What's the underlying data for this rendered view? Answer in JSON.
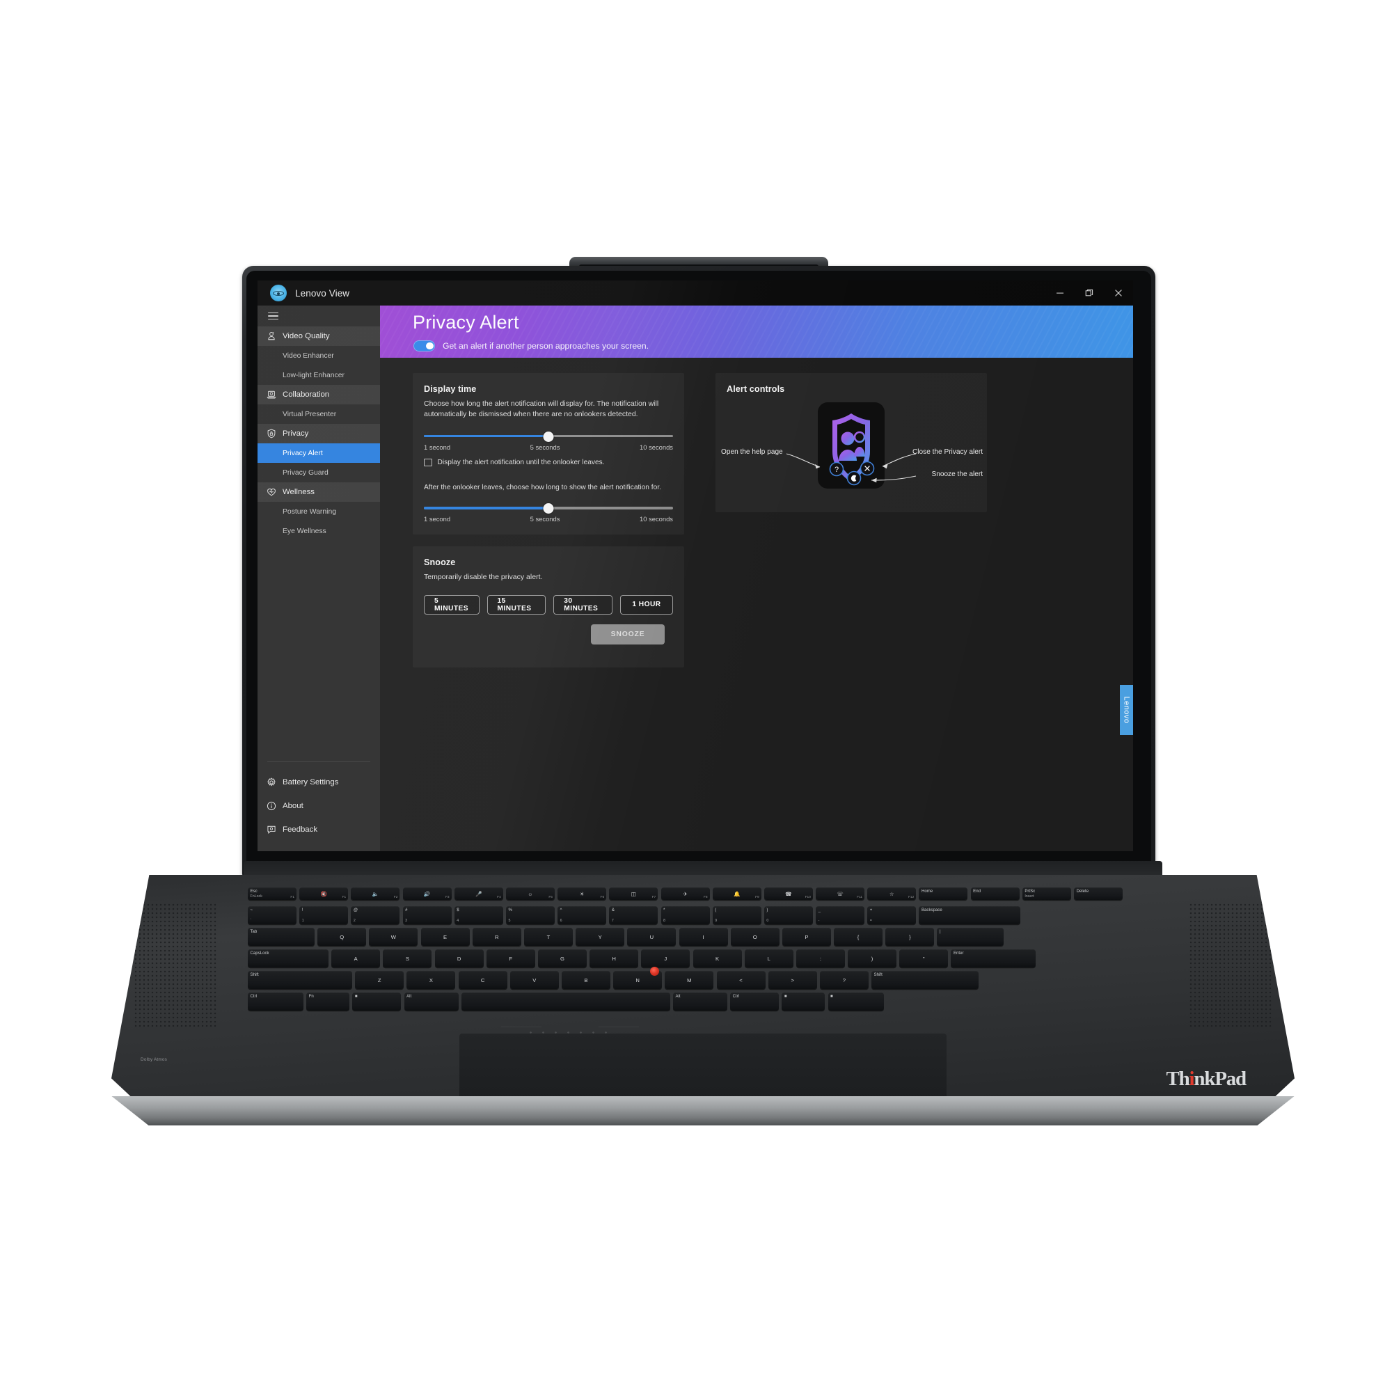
{
  "app": {
    "title": "Lenovo View",
    "logo_icon": "lenovo-view-eye-logo",
    "window_controls": [
      {
        "name": "minimize",
        "icon": "minimize-icon"
      },
      {
        "name": "maximize",
        "icon": "restore-window-icon"
      },
      {
        "name": "close",
        "icon": "close-icon"
      }
    ]
  },
  "sidebar": {
    "menu_icon": "hamburger-menu-icon",
    "groups": [
      {
        "label": "Video Quality",
        "icon": "webcam-person-icon",
        "items": [
          {
            "label": "Video Enhancer",
            "active": false
          },
          {
            "label": "Low-light Enhancer",
            "active": false
          }
        ]
      },
      {
        "label": "Collaboration",
        "icon": "laptop-presenter-icon",
        "items": [
          {
            "label": "Virtual Presenter",
            "active": false
          }
        ]
      },
      {
        "label": "Privacy",
        "icon": "shield-lock-icon",
        "items": [
          {
            "label": "Privacy Alert",
            "active": true
          },
          {
            "label": "Privacy Guard",
            "active": false
          }
        ]
      },
      {
        "label": "Wellness",
        "icon": "heart-pulse-icon",
        "items": [
          {
            "label": "Posture Warning",
            "active": false
          },
          {
            "label": "Eye Wellness",
            "active": false
          }
        ]
      }
    ],
    "footer": [
      {
        "label": "Battery Settings",
        "icon": "gear-icon"
      },
      {
        "label": "About",
        "icon": "info-circle-icon"
      },
      {
        "label": "Feedback",
        "icon": "feedback-chat-icon"
      }
    ]
  },
  "banner": {
    "title": "Privacy Alert",
    "toggle_on": true,
    "toggle_label": "Get an alert if another person approaches your screen.",
    "gradient_from": "#9b45d4",
    "gradient_to": "#3f95e6"
  },
  "display_time": {
    "heading": "Display time",
    "description": "Choose how long the alert notification will display for. The notification will automatically be dismissed when there are no onlookers detected.",
    "slider1": {
      "min_label": "1 second",
      "mid_label": "5 seconds",
      "max_label": "10 seconds",
      "value": 5,
      "min": 1,
      "max": 10,
      "fill_percent": 50
    },
    "checkbox": {
      "label": "Display the alert notification until the onlooker leaves.",
      "checked": false
    },
    "subdescription": "After the onlooker leaves, choose how long to show the alert notification for.",
    "slider2": {
      "min_label": "1 second",
      "mid_label": "5 seconds",
      "max_label": "10 seconds",
      "value": 5,
      "min": 1,
      "max": 10,
      "fill_percent": 50
    }
  },
  "snooze": {
    "heading": "Snooze",
    "description": "Temporarily disable the privacy alert.",
    "options": [
      {
        "label": "5 MINUTES"
      },
      {
        "label": "15 MINUTES"
      },
      {
        "label": "30 MINUTES"
      },
      {
        "label": "1 HOUR"
      }
    ],
    "action_label": "SNOOZE",
    "action_enabled": false
  },
  "alert_controls": {
    "heading": "Alert controls",
    "graphic_icon": "privacy-shield-onlooker-icon",
    "annotations": [
      {
        "label": "Open the help page",
        "target_icon": "question-mark-icon"
      },
      {
        "label": "Close the Privacy alert",
        "target_icon": "close-x-icon"
      },
      {
        "label": "Snooze the alert",
        "target_icon": "moon-icon"
      }
    ]
  },
  "device": {
    "side_badge": "Lenovo",
    "brand_logo": "ThinkPad",
    "audio_label": "Dolby Atmos"
  },
  "keyboard": {
    "row_fn": [
      {
        "top": "Esc",
        "bottom": "FnLock",
        "fn": "F1"
      },
      {
        "icon": "mute-speaker-icon",
        "fn": "F1"
      },
      {
        "icon": "volume-down-icon",
        "fn": "F2"
      },
      {
        "icon": "volume-up-icon",
        "fn": "F3"
      },
      {
        "icon": "mic-mute-icon",
        "fn": "F4"
      },
      {
        "icon": "brightness-down-icon",
        "fn": "F5"
      },
      {
        "icon": "brightness-up-icon",
        "fn": "F6"
      },
      {
        "icon": "external-display-icon",
        "fn": "F7"
      },
      {
        "icon": "airplane-mode-icon",
        "fn": "F8"
      },
      {
        "icon": "notifications-icon",
        "fn": "F9"
      },
      {
        "icon": "answer-call-icon",
        "fn": "F10"
      },
      {
        "icon": "end-call-icon",
        "fn": "F11"
      },
      {
        "icon": "star-favorite-icon",
        "fn": "F12"
      },
      {
        "top": "Home"
      },
      {
        "top": "End"
      },
      {
        "top": "PrtSc",
        "bottom": "Insert"
      },
      {
        "top": "Delete"
      }
    ],
    "row_numbers": [
      {
        "top": "~",
        "bottom": "`"
      },
      {
        "top": "!",
        "bottom": "1"
      },
      {
        "top": "@",
        "bottom": "2"
      },
      {
        "top": "#",
        "bottom": "3"
      },
      {
        "top": "$",
        "bottom": "4"
      },
      {
        "top": "%",
        "bottom": "5"
      },
      {
        "top": "^",
        "bottom": "6"
      },
      {
        "top": "&",
        "bottom": "7"
      },
      {
        "top": "*",
        "bottom": "8"
      },
      {
        "top": "(",
        "bottom": "9"
      },
      {
        "top": ")",
        "bottom": "0"
      },
      {
        "top": "_",
        "bottom": "-"
      },
      {
        "top": "+",
        "bottom": "="
      },
      {
        "top": "Backspace"
      }
    ],
    "row_q": [
      "Tab",
      "Q",
      "W",
      "E",
      "R",
      "T",
      "Y",
      "U",
      "I",
      "O",
      "P",
      "{",
      "}",
      "|"
    ],
    "row_a": [
      "CapsLock",
      "A",
      "S",
      "D",
      "F",
      "G",
      "H",
      "J",
      "K",
      "L",
      ":",
      ")",
      "\"",
      "Enter"
    ],
    "row_z": [
      "Shift",
      "Z",
      "X",
      "C",
      "V",
      "B",
      "N",
      "M",
      "<",
      ">",
      "?",
      "Shift"
    ],
    "row_ctrl": [
      "Ctrl",
      "Fn",
      "Alt",
      "Alt",
      "Ctrl"
    ]
  }
}
